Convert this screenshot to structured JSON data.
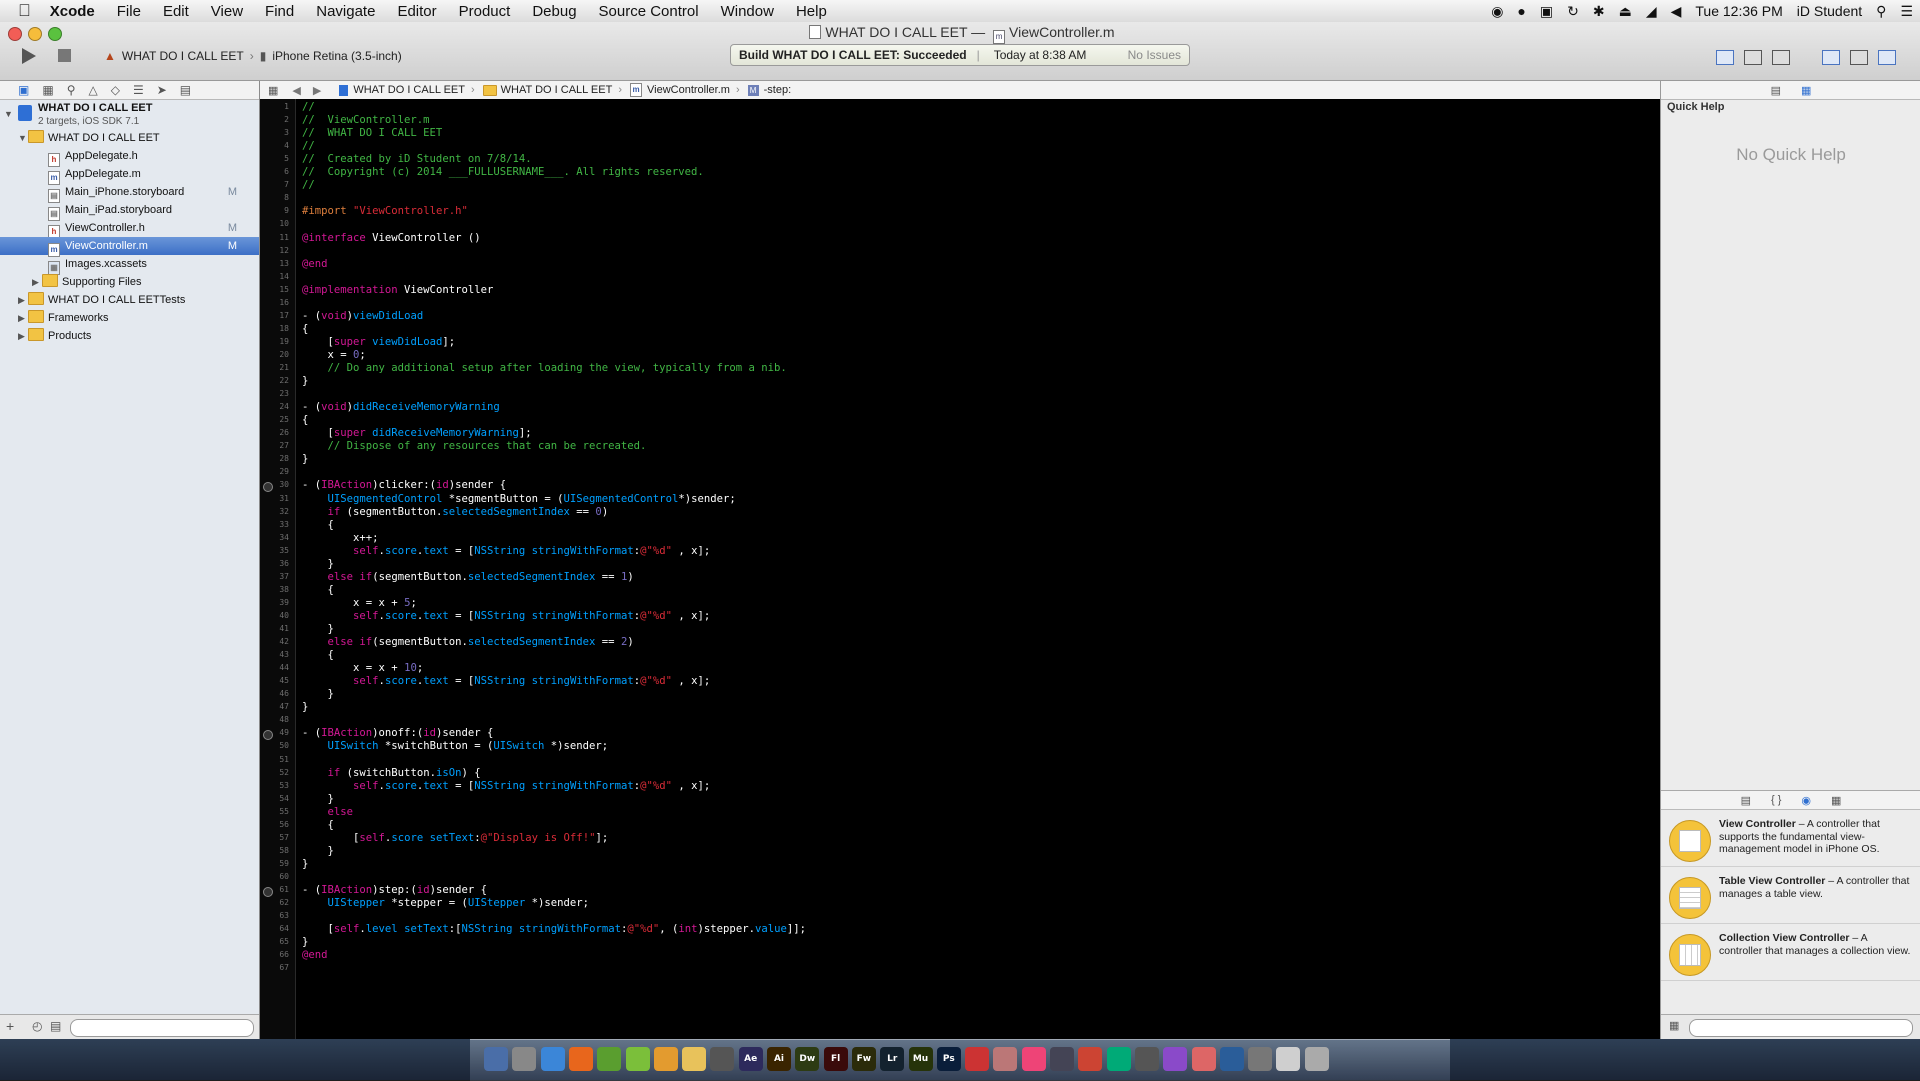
{
  "menubar": {
    "app": "Xcode",
    "items": [
      "File",
      "Edit",
      "View",
      "Find",
      "Navigate",
      "Editor",
      "Product",
      "Debug",
      "Source Control",
      "Window",
      "Help"
    ],
    "clock": "Tue 12:36 PM",
    "user": "iD Student"
  },
  "window": {
    "title_project": "WHAT DO I CALL EET",
    "title_sep": "—",
    "title_file": "ViewController.m"
  },
  "toolbar": {
    "scheme": "WHAT DO I CALL EET",
    "scheme_sep": "›",
    "destination": "iPhone Retina (3.5-inch)",
    "activity_status": "Build WHAT DO I CALL EET: Succeeded",
    "activity_time": "Today at 8:38 AM",
    "activity_issues": "No Issues"
  },
  "navigator": {
    "project": "WHAT DO I CALL EET",
    "project_sub": "2 targets, iOS SDK 7.1",
    "items": [
      {
        "label": "WHAT DO I CALL EET",
        "kind": "group"
      },
      {
        "label": "AppDelegate.h",
        "kind": "h",
        "status": ""
      },
      {
        "label": "AppDelegate.m",
        "kind": "m",
        "status": ""
      },
      {
        "label": "Main_iPhone.storyboard",
        "kind": "sb",
        "status": "M"
      },
      {
        "label": "Main_iPad.storyboard",
        "kind": "sb",
        "status": ""
      },
      {
        "label": "ViewController.h",
        "kind": "h",
        "status": "M"
      },
      {
        "label": "ViewController.m",
        "kind": "m",
        "status": "M"
      },
      {
        "label": "Images.xcassets",
        "kind": "assets",
        "status": ""
      },
      {
        "label": "Supporting Files",
        "kind": "group"
      },
      {
        "label": "WHAT DO I CALL EETTests",
        "kind": "group"
      },
      {
        "label": "Frameworks",
        "kind": "group"
      },
      {
        "label": "Products",
        "kind": "group"
      }
    ]
  },
  "jumpbar": {
    "crumbs": [
      "WHAT DO I CALL EET",
      "WHAT DO I CALL EET",
      "ViewController.m",
      "-step:"
    ]
  },
  "editor": {
    "lines": [
      "//",
      "//  ViewController.m",
      "//  WHAT DO I CALL EET",
      "//",
      "//  Created by iD Student on 7/8/14.",
      "//  Copyright (c) 2014 ___FULLUSERNAME___. All rights reserved.",
      "//",
      "",
      "#import \"ViewController.h\"",
      "",
      "@interface ViewController ()",
      "",
      "@end",
      "",
      "@implementation ViewController",
      "",
      "- (void)viewDidLoad",
      "{",
      "    [super viewDidLoad];",
      "    x = 0;",
      "    // Do any additional setup after loading the view, typically from a nib.",
      "}",
      "",
      "- (void)didReceiveMemoryWarning",
      "{",
      "    [super didReceiveMemoryWarning];",
      "    // Dispose of any resources that can be recreated.",
      "}",
      "",
      "- (IBAction)clicker:(id)sender {",
      "    UISegmentedControl *segmentButton = (UISegmentedControl*)sender;",
      "    if (segmentButton.selectedSegmentIndex == 0)",
      "    {",
      "        x++;",
      "        self.score.text = [NSString stringWithFormat:@\"%d\" , x];",
      "    }",
      "    else if(segmentButton.selectedSegmentIndex == 1)",
      "    {",
      "        x = x + 5;",
      "        self.score.text = [NSString stringWithFormat:@\"%d\" , x];",
      "    }",
      "    else if(segmentButton.selectedSegmentIndex == 2)",
      "    {",
      "        x = x + 10;",
      "        self.score.text = [NSString stringWithFormat:@\"%d\" , x];",
      "    }",
      "}",
      "",
      "- (IBAction)onoff:(id)sender {",
      "    UISwitch *switchButton = (UISwitch *)sender;",
      "",
      "    if (switchButton.isOn) {",
      "        self.score.text = [NSString stringWithFormat:@\"%d\" , x];",
      "    }",
      "    else",
      "    {",
      "        [self.score setText:@\"Display is Off!\"];",
      "    }",
      "}",
      "",
      "- (IBAction)step:(id)sender {",
      "    UIStepper *stepper = (UIStepper *)sender;",
      "",
      "    [self.level setText:[NSString stringWithFormat:@\"%d\", (int)stepper.value]];",
      "}",
      "@end",
      ""
    ],
    "breakpoint_lines": [
      30,
      49,
      61
    ]
  },
  "utilities": {
    "quick_help_title": "Quick Help",
    "quick_help_empty": "No Quick Help",
    "library": [
      {
        "name": "View Controller",
        "desc": " – A controller that supports the fundamental view-management model in iPhone OS.",
        "icon": "view-controller-icon"
      },
      {
        "name": "Table View Controller",
        "desc": " – A controller that manages a table view.",
        "icon": "table-view-controller-icon"
      },
      {
        "name": "Collection View Controller",
        "desc": " – A controller that manages a collection view.",
        "icon": "collection-view-controller-icon"
      }
    ]
  },
  "dock": {
    "labels": [
      "Ae",
      "Ai",
      "Dw",
      "Fl",
      "Fw",
      "Lr",
      "Mu",
      "Ps"
    ]
  },
  "colors": {
    "comment": "#41b645",
    "keyword": "#d31895",
    "preprocessor": "#de7f3d",
    "string": "#db2c38",
    "number": "#786dc4",
    "class": "#00a0ff",
    "selection": "#3c6fc6"
  }
}
